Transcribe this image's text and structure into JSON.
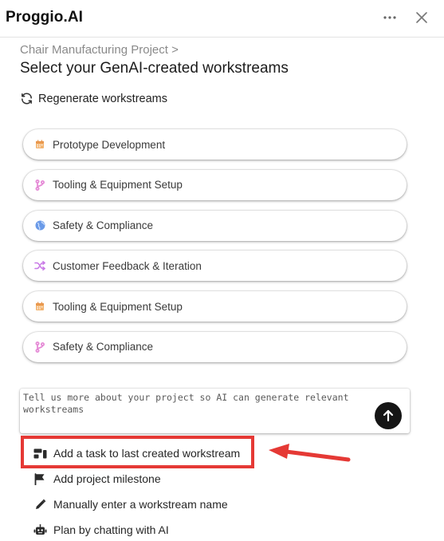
{
  "app": {
    "title": "Proggio.AI"
  },
  "topbar": {
    "more_icon": "more-horizontal-icon",
    "close_icon": "close-icon"
  },
  "header": {
    "breadcrumb": "Chair Manufacturing Project >",
    "title": "Select your GenAI-created workstreams"
  },
  "regenerate": {
    "label": "Regenerate workstreams",
    "icon": "refresh-icon"
  },
  "workstreams": [
    {
      "label": "Prototype Development",
      "icon": "calendar-icon",
      "color": "#f0a050"
    },
    {
      "label": "Tooling & Equipment Setup",
      "icon": "branch-icon",
      "color": "#e58ad6"
    },
    {
      "label": "Safety & Compliance",
      "icon": "globe-icon",
      "color": "#5b8fe8"
    },
    {
      "label": "Customer Feedback & Iteration",
      "icon": "shuffle-icon",
      "color": "#c879e6"
    },
    {
      "label": "Tooling & Equipment Setup",
      "icon": "calendar-icon",
      "color": "#f0a050"
    },
    {
      "label": "Safety & Compliance",
      "icon": "branch-icon",
      "color": "#e58ad6"
    }
  ],
  "prompt": {
    "placeholder": "Tell us more about your project so AI can generate relevant workstreams",
    "send_icon": "arrow-up-icon"
  },
  "actions": [
    {
      "label": "Add a task to last created workstream",
      "icon": "task-icon"
    },
    {
      "label": "Add project milestone",
      "icon": "flag-icon"
    },
    {
      "label": "Manually enter a workstream name",
      "icon": "pencil-icon"
    },
    {
      "label": "Plan by chatting with AI",
      "icon": "robot-icon"
    }
  ],
  "annotation": {
    "highlight_color": "#e53935"
  }
}
